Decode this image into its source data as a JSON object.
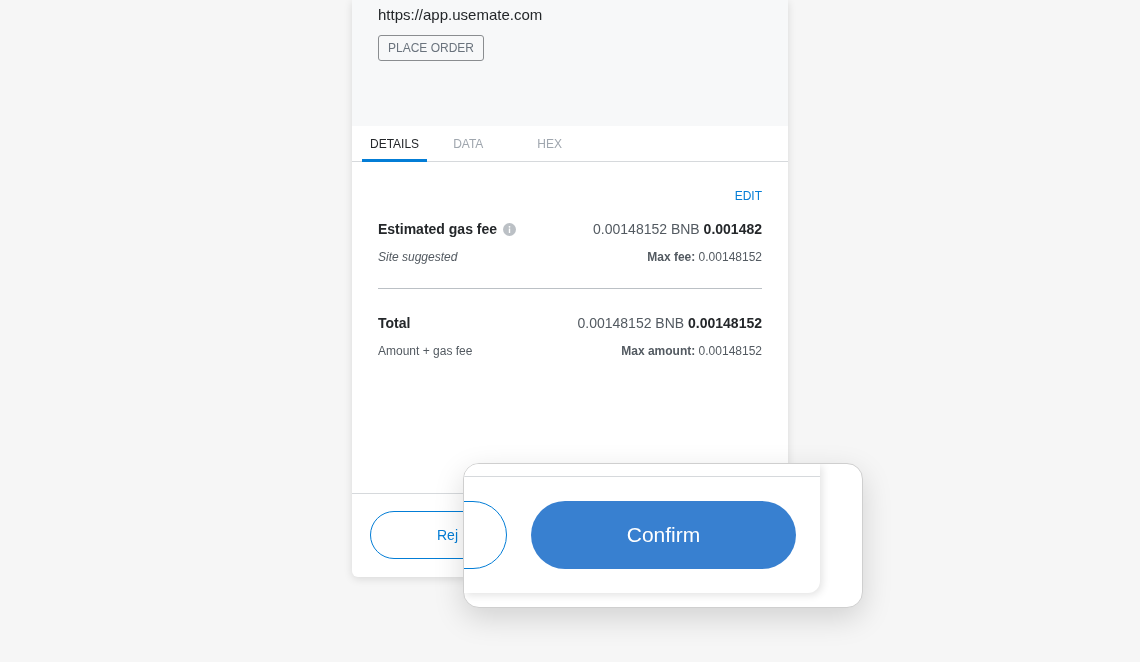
{
  "origin": {
    "url": "https://app.usemate.com",
    "method_badge": "PLACE ORDER"
  },
  "tabs": [
    {
      "label": "DETAILS",
      "selected": true
    },
    {
      "label": "DATA",
      "selected": false
    },
    {
      "label": "HEX",
      "selected": false
    }
  ],
  "edit_link": "EDIT",
  "gas_fee": {
    "label": "Estimated gas fee",
    "value": "0.00148152 BNB",
    "value_bold": "0.001482",
    "note": "Site suggested",
    "max": "**Max fee:** 0.00148152"
  },
  "total": {
    "label": "Total",
    "value": "0.00148152 BNB",
    "value_bold": "0.00148152",
    "note": "Amount + gas fee",
    "max": "**Max amount:** 0.00148152"
  },
  "footer": {
    "reject_button": "Rej"
  },
  "zoom_overlay": {
    "confirm_button": "Confirm"
  }
}
